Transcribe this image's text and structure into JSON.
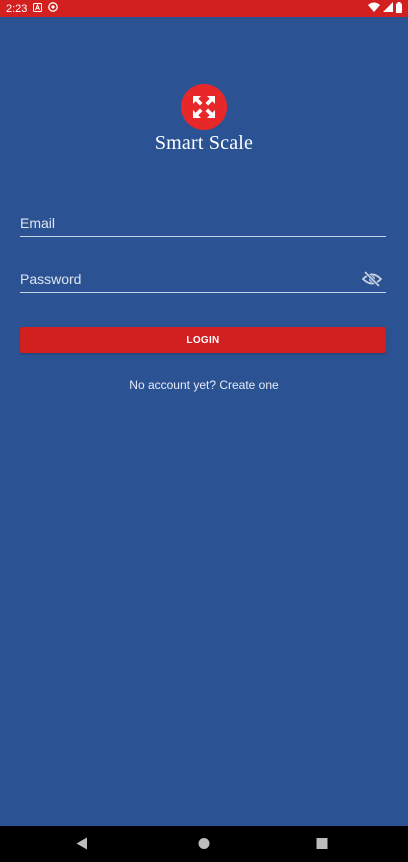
{
  "status_bar": {
    "time": "2:23"
  },
  "app": {
    "name": "Smart Scale",
    "accent": "#e82828",
    "background": "#2b5394"
  },
  "form": {
    "email_placeholder": "Email",
    "password_placeholder": "Password",
    "login_label": "LOGIN",
    "create_account_text": "No account yet? Create one"
  },
  "icons": {
    "logo": "expand-arrows-icon",
    "password_toggle": "eye-off-icon",
    "nav_back": "back-triangle-icon",
    "nav_home": "home-circle-icon",
    "nav_recents": "recents-square-icon"
  }
}
